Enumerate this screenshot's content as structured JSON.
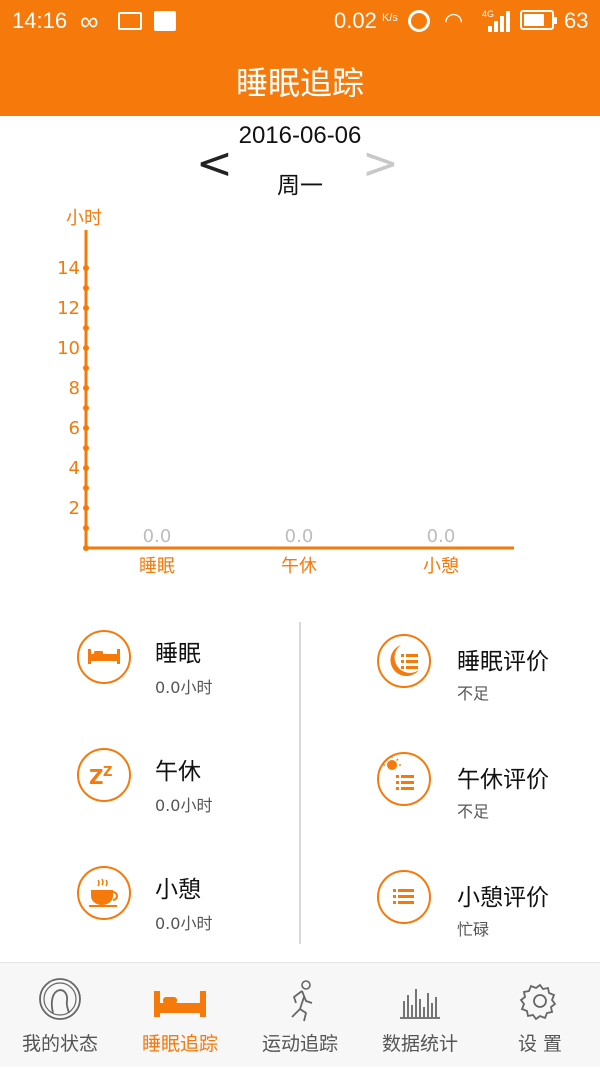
{
  "status_bar": {
    "time": "14:16",
    "infinity_icon": "∞",
    "net_speed": "0.02",
    "net_speed_unit": "K/s",
    "network_type": "4G",
    "battery_level": "63"
  },
  "header": {
    "title": "睡眠追踪"
  },
  "date_nav": {
    "date": "2016-06-06",
    "weekday": "周一",
    "prev_symbol": "<",
    "next_symbol": ">"
  },
  "chart_data": {
    "type": "bar",
    "ylabel": "小时",
    "categories": [
      "睡眠",
      "午休",
      "小憩"
    ],
    "values": [
      0.0,
      0.0,
      0.0
    ],
    "value_labels": [
      "0.0",
      "0.0",
      "0.0"
    ],
    "y_ticks": [
      2,
      4,
      6,
      8,
      10,
      12,
      14
    ],
    "ylim": [
      0,
      14
    ],
    "grid": false,
    "color": "#f5790b"
  },
  "stats": {
    "sleep": {
      "label": "睡眠",
      "value": "0.0小时",
      "icon": "bed-icon"
    },
    "nap": {
      "label": "午休",
      "value": "0.0小时",
      "icon": "zzz-icon"
    },
    "rest": {
      "label": "小憩",
      "value": "0.0小时",
      "icon": "coffee-cup-icon"
    },
    "sleep_eval": {
      "label": "睡眠评价",
      "value": "不足",
      "icon": "moon-list-icon"
    },
    "nap_eval": {
      "label": "午休评价",
      "value": "不足",
      "icon": "sun-list-icon"
    },
    "rest_eval": {
      "label": "小憩评价",
      "value": "忙碌",
      "icon": "list-icon"
    }
  },
  "tabs": [
    {
      "label": "我的状态",
      "icon": "head-profile-icon"
    },
    {
      "label": "睡眠追踪",
      "icon": "bed-icon",
      "active": true
    },
    {
      "label": "运动追踪",
      "icon": "runner-icon"
    },
    {
      "label": "数据统计",
      "icon": "bar-stats-icon"
    },
    {
      "label": "设 置",
      "icon": "gear-icon"
    }
  ],
  "colors": {
    "accent": "#f5790b",
    "muted": "#bdbdbd"
  }
}
